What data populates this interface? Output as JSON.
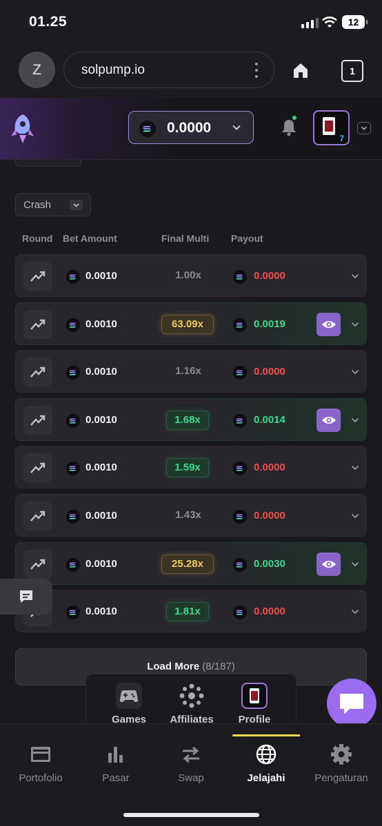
{
  "status_bar": {
    "time": "01.25",
    "battery": "12"
  },
  "browser": {
    "avatar_initial": "Z",
    "url": "solpump.io",
    "tab_count": "1"
  },
  "header": {
    "balance": "0.0000",
    "level": "7"
  },
  "filter": {
    "game_label": "Crash"
  },
  "table": {
    "columns": [
      "Round",
      "Bet Amount",
      "Final Multi",
      "Payout"
    ],
    "rows": [
      {
        "bet": "0.0010",
        "multi": "1.00x",
        "multi_style": "gray",
        "payout": "0.0000",
        "win": false
      },
      {
        "bet": "0.0010",
        "multi": "63.09x",
        "multi_style": "gold",
        "payout": "0.0019",
        "win": true
      },
      {
        "bet": "0.0010",
        "multi": "1.16x",
        "multi_style": "gray",
        "payout": "0.0000",
        "win": false
      },
      {
        "bet": "0.0010",
        "multi": "1.68x",
        "multi_style": "green",
        "payout": "0.0014",
        "win": true
      },
      {
        "bet": "0.0010",
        "multi": "1.59x",
        "multi_style": "green",
        "payout": "0.0000",
        "win": false
      },
      {
        "bet": "0.0010",
        "multi": "1.43x",
        "multi_style": "gray",
        "payout": "0.0000",
        "win": false
      },
      {
        "bet": "0.0010",
        "multi": "25.28x",
        "multi_style": "gold",
        "payout": "0.0030",
        "win": true
      },
      {
        "bet": "0.0010",
        "multi": "1.81x",
        "multi_style": "green",
        "payout": "0.0000",
        "win": false
      }
    ]
  },
  "load_more": {
    "label": "Load More",
    "count": "(8/187)"
  },
  "popup_menu": {
    "items": [
      "Games",
      "Affiliates",
      "Profile"
    ]
  },
  "bottom_nav": {
    "items": [
      "Portofolio",
      "Pasar",
      "Swap",
      "Jelajahi",
      "Pengaturan"
    ],
    "active": "Jelajahi"
  },
  "colors": {
    "accent_purple": "#9a6cf0",
    "win_green": "#3ed98f",
    "loss_red": "#f0504a",
    "gold": "#f0c865",
    "active_indicator": "#f3dc55"
  }
}
